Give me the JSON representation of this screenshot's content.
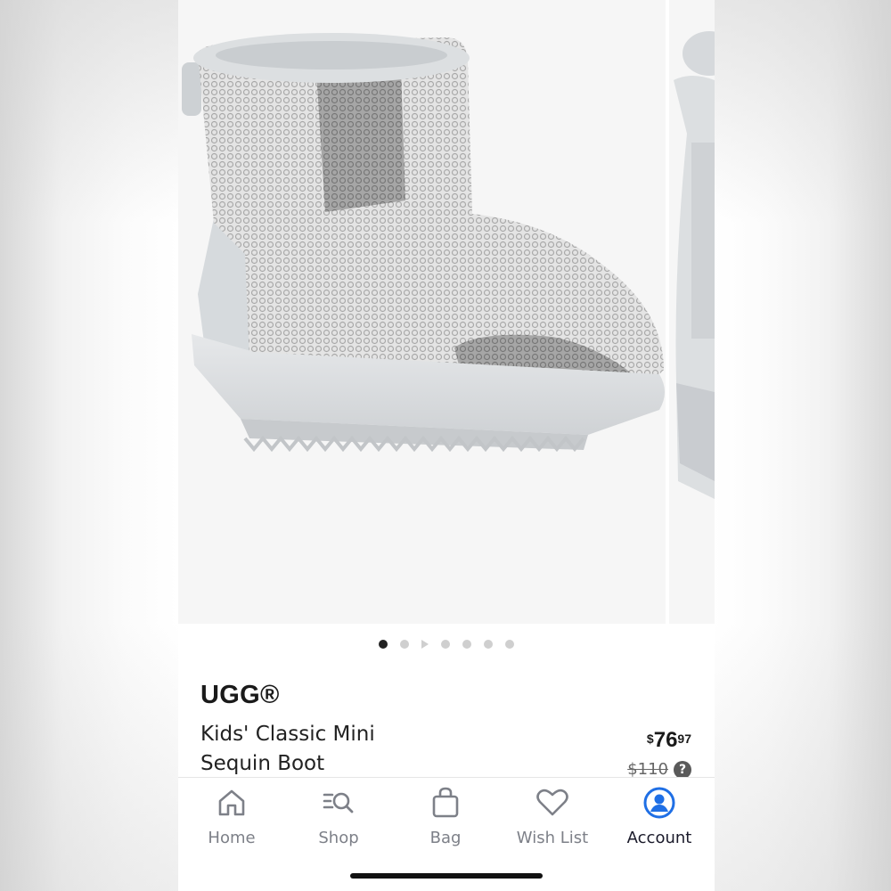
{
  "product": {
    "brand": "UGG®",
    "name_line1": "Kids' Classic Mini",
    "name_line2": "Sequin Boot",
    "price_currency": "$",
    "price_whole": "76",
    "price_cents": "97",
    "original_price": "$110",
    "help_icon": "?"
  },
  "carousel": {
    "image_main": "boot-image",
    "image_next": "boot-image-partial",
    "active_index": 1,
    "total_slides": 7,
    "video_slide_index": 3
  },
  "tabbar": {
    "home": "Home",
    "shop": "Shop",
    "bag": "Bag",
    "wishlist": "Wish List",
    "account": "Account",
    "active": "account"
  },
  "colors": {
    "accent": "#1f6fe5",
    "text": "#1a1a1a",
    "muted": "#7d8088"
  }
}
